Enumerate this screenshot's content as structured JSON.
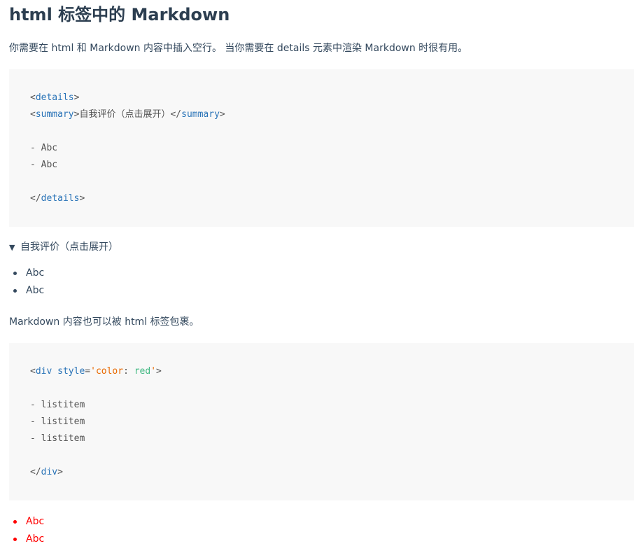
{
  "title": "html 标签中的 Markdown",
  "intro": "你需要在 html 和 Markdown 内容中插入空行。 当你需要在 details 元素中渲染 Markdown 时很有用。",
  "code1": {
    "line1_open": "<",
    "line1_tag": "details",
    "line1_close": ">",
    "line2_open": "<",
    "line2_tag": "summary",
    "line2_mid_close": ">",
    "line2_text": "自我评价（点击展开）",
    "line2_end_open": "</",
    "line2_end_tag": "summary",
    "line2_end_close": ">",
    "line3": "- Abc",
    "line4": "- Abc",
    "line5_open": "</",
    "line5_tag": "details",
    "line5_close": ">"
  },
  "details": {
    "arrow": "▼",
    "summary": "自我评价（点击展开）",
    "items": [
      "Abc",
      "Abc"
    ]
  },
  "para2": "Markdown 内容也可以被 html 标签包裹。",
  "code2": {
    "line1_open": "<",
    "line1_tag": "div",
    "line1_attr": "style",
    "line1_eq": "=",
    "line1_q1": "'",
    "line1_key": "color",
    "line1_colon": ": ",
    "line1_val": "red",
    "line1_q2": "'",
    "line1_close": ">",
    "line2": "- listitem",
    "line3": "- listitem",
    "line4": "- listitem",
    "line5_open": "</",
    "line5_tag": "div",
    "line5_close": ">"
  },
  "red_list": {
    "items": [
      "Abc",
      "Abc"
    ],
    "color": "#ff0000"
  },
  "colors": {
    "text": "#34495e",
    "code_bg": "#f8f8f8",
    "tag": "#2973b7",
    "string": "#42b983"
  }
}
